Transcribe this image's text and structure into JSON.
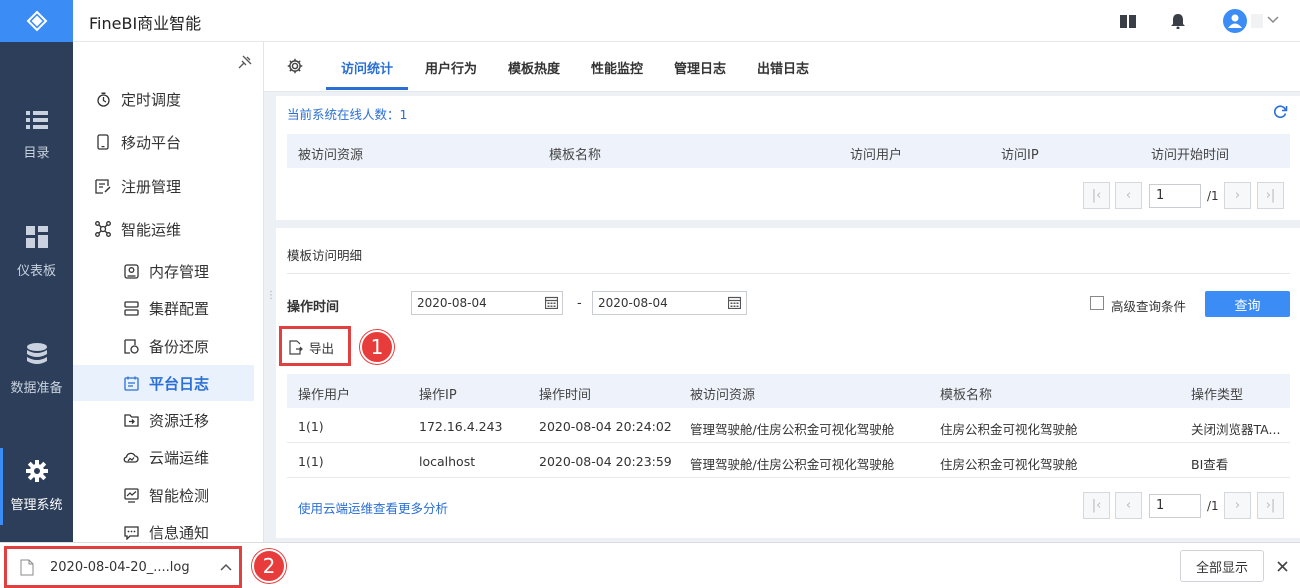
{
  "app": {
    "title": "FineBI商业智能"
  },
  "nav": [
    {
      "label": "目录",
      "icon": "list-icon"
    },
    {
      "label": "仪表板",
      "icon": "dashboard-icon"
    },
    {
      "label": "数据准备",
      "icon": "database-icon"
    },
    {
      "label": "管理系统",
      "icon": "gear-icon",
      "active": true
    }
  ],
  "sidebar": {
    "items": [
      {
        "label": "定时调度",
        "icon": "timer-icon"
      },
      {
        "label": "移动平台",
        "icon": "mobile-icon"
      },
      {
        "label": "注册管理",
        "icon": "register-icon"
      },
      {
        "label": "智能运维",
        "icon": "network-icon"
      },
      {
        "label": "内存管理",
        "icon": "memory-icon"
      },
      {
        "label": "集群配置",
        "icon": "cluster-icon"
      },
      {
        "label": "备份还原",
        "icon": "backup-icon"
      },
      {
        "label": "平台日志",
        "icon": "log-icon",
        "active": true
      },
      {
        "label": "资源迁移",
        "icon": "migrate-icon"
      },
      {
        "label": "云端运维",
        "icon": "cloud-icon"
      },
      {
        "label": "智能检测",
        "icon": "monitor-icon"
      },
      {
        "label": "信息通知",
        "icon": "message-icon"
      }
    ]
  },
  "tabs": [
    "访问统计",
    "用户行为",
    "模板热度",
    "性能监控",
    "管理日志",
    "出错日志"
  ],
  "online": {
    "label": "当前系统在线人数：1",
    "columns": [
      "被访问资源",
      "模板名称",
      "访问用户",
      "访问IP",
      "访问开始时间"
    ],
    "page": "1",
    "total": "/1"
  },
  "detail": {
    "title": "模板访问明细",
    "time_label": "操作时间",
    "start_date": "2020-08-04",
    "end_date": "2020-08-04",
    "dash": "-",
    "advanced_label": "高级查询条件",
    "query_button": "查询",
    "export_button": "导出",
    "columns": [
      "操作用户",
      "操作IP",
      "操作时间",
      "被访问资源",
      "模板名称",
      "操作类型"
    ],
    "rows": [
      [
        "1(1)",
        "172.16.4.243",
        "2020-08-04 20:24:02",
        "管理驾驶舱/住房公积金可视化驾驶舱",
        "住房公积金可视化驾驶舱",
        "关闭浏览器TA..."
      ],
      [
        "1(1)",
        "localhost",
        "2020-08-04 20:23:59",
        "管理驾驶舱/住房公积金可视化驾驶舱",
        "住房公积金可视化驾驶舱",
        "BI查看"
      ]
    ],
    "more_link": "使用云端运维查看更多分析",
    "page": "1",
    "total": "/1"
  },
  "annotations": {
    "step1": "1",
    "step2": "2"
  },
  "download": {
    "file": "2020-08-04-20_....log",
    "show_all": "全部显示"
  },
  "colors": {
    "accent": "#2a6fd6",
    "nav_bg": "#2c3e59",
    "logo_bg": "#3b8cf5",
    "highlight": "#e04040"
  }
}
